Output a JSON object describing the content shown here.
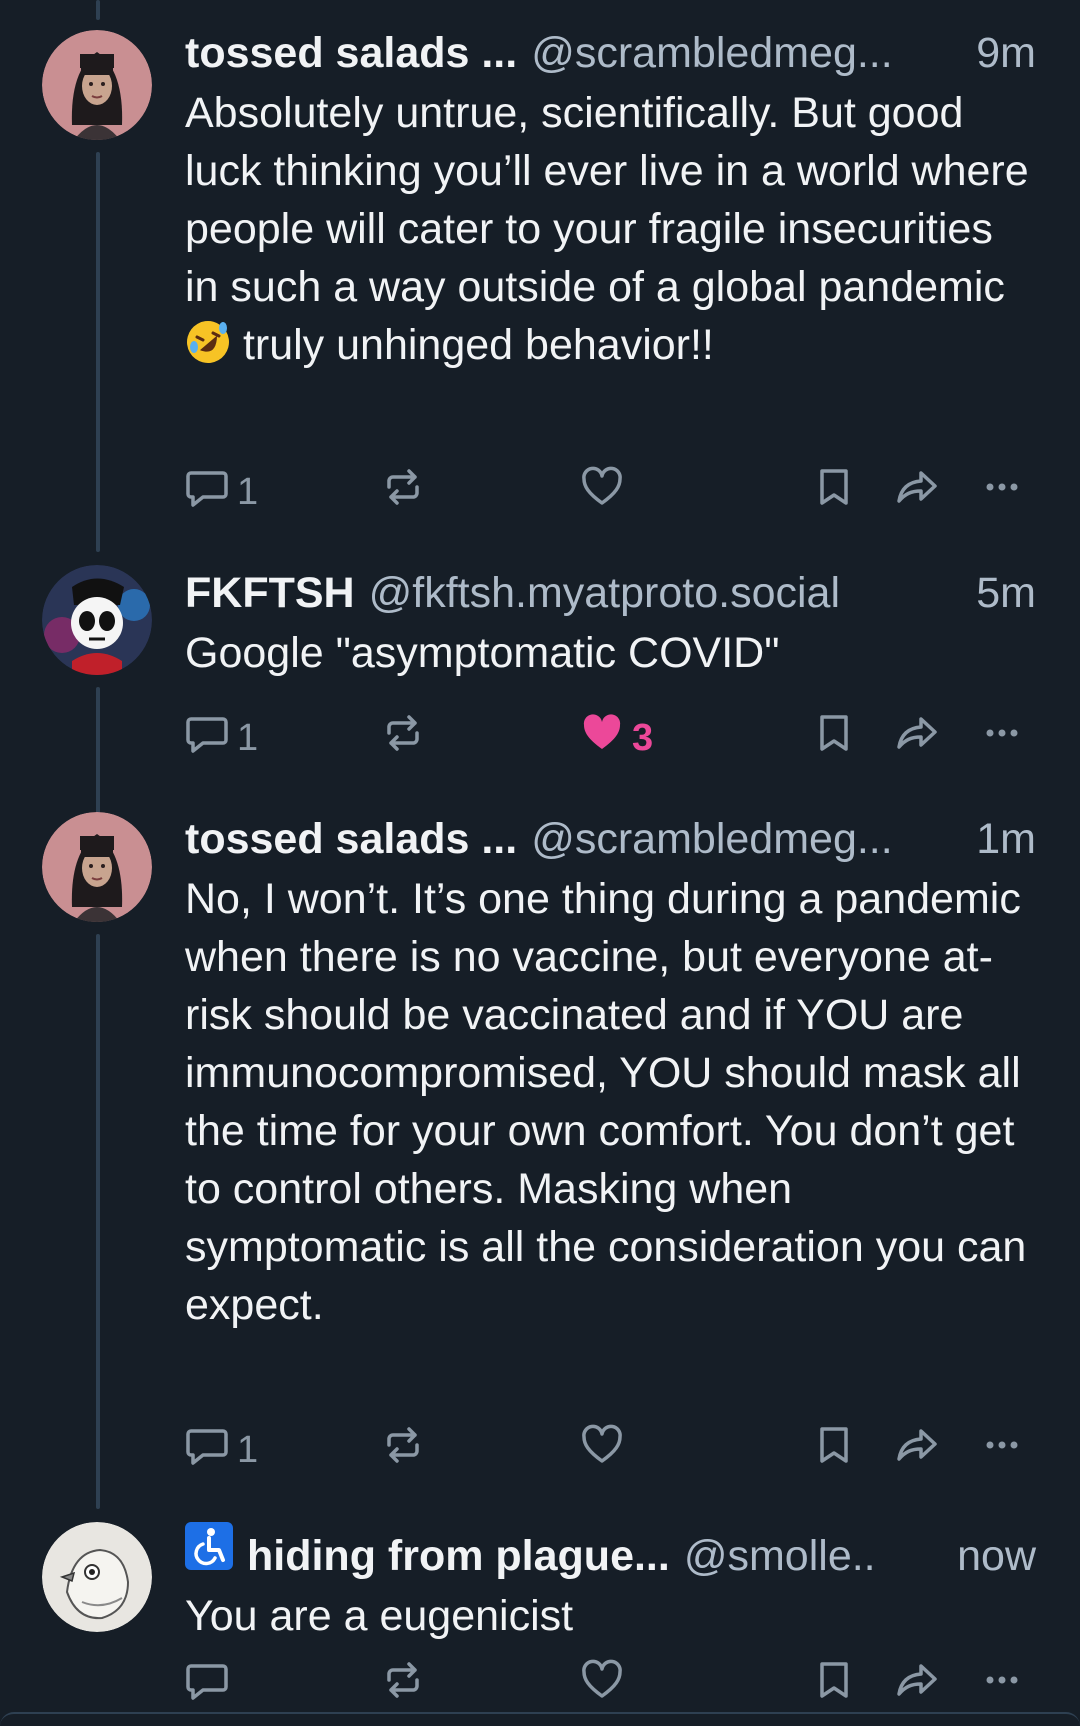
{
  "posts": [
    {
      "name": "tossed salads ...",
      "handle": "@scrambledmeg...",
      "time": "9m",
      "text_before_emoji": "Absolutely untrue, scientifically. But good luck thinking you’ll ever live in a world where people will cater to your fragile insecurities in such a way outside of a global pandemic ",
      "emoji": "rofl",
      "text_after_emoji": " truly unhinged behavior!!",
      "reply_count": "1",
      "like_count": "",
      "liked": false
    },
    {
      "name": "FKFTSH",
      "handle": "@fkftsh.myatproto.social",
      "time": "5m",
      "text": "Google \"asymptomatic COVID\"",
      "reply_count": "1",
      "like_count": "3",
      "liked": true
    },
    {
      "name": "tossed salads ...",
      "handle": "@scrambledmeg...",
      "time": "1m",
      "text": "No, I won’t. It’s one thing during a pandemic when there is no vaccine, but everyone at-risk should be vaccinated and if YOU are immunocompromised, YOU should mask all the time for your own comfort. You don’t get to control others. Masking when symptomatic is all the consideration you can expect.",
      "reply_count": "1",
      "like_count": "",
      "liked": false
    },
    {
      "badge": "accessibility-icon",
      "name": "hiding from plague...",
      "handle": "@smolle..",
      "time": "now",
      "text": "You are a eugenicist",
      "reply_count": "",
      "like_count": "",
      "liked": false
    }
  ],
  "colors": {
    "background": "#161e27",
    "muted_text": "#aebbc9",
    "icon": "#8b98a5",
    "like": "#ec4899",
    "thread_line": "#2e4052"
  },
  "icons": {
    "reply": "speech-bubble-icon",
    "repost": "repost-arrows-icon",
    "like": "heart-icon",
    "bookmark": "bookmark-icon",
    "share": "share-arrow-icon",
    "more": "ellipsis-icon"
  }
}
